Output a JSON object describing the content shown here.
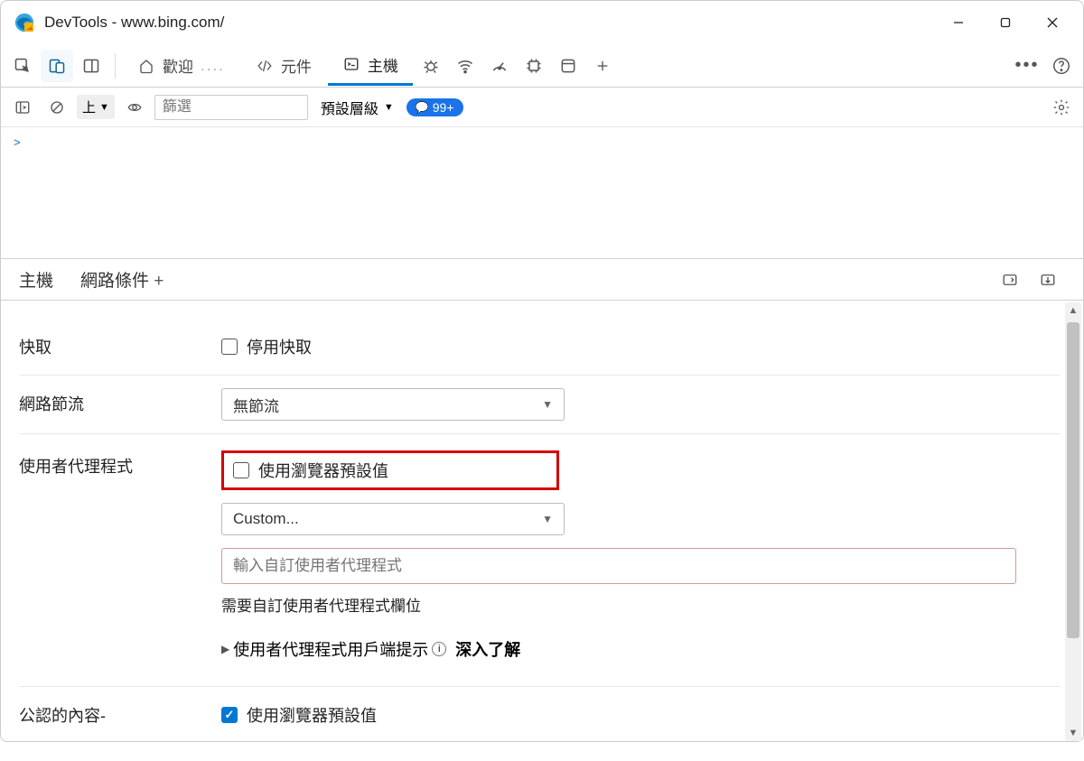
{
  "window": {
    "title": "DevTools - www.bing.com/"
  },
  "tabs": {
    "welcome": "歡迎",
    "elements": "元件",
    "console": "主機"
  },
  "toolbar": {
    "context": "上",
    "filter_placeholder": "篩選",
    "level_default": "預設層級",
    "issues_badge": "99+"
  },
  "drawer": {
    "tab_console": "主機",
    "tab_network_conditions": "網路條件"
  },
  "network_conditions": {
    "cache_label": "快取",
    "disable_cache": "停用快取",
    "throttling_label": "網路節流",
    "throttling_value": "無節流",
    "user_agent_label": "使用者代理程式",
    "use_browser_default": "使用瀏覽器預設值",
    "ua_select_value": "Custom...",
    "ua_input_placeholder": "輸入自訂使用者代理程式",
    "ua_required_hint": "需要自訂使用者代理程式欄位",
    "client_hints": "使用者代理程式用戶端提示",
    "learn_more": "深入了解",
    "accepted_content_label": "公認的內容-",
    "accepted_use_default": "使用瀏覽器預設值"
  }
}
